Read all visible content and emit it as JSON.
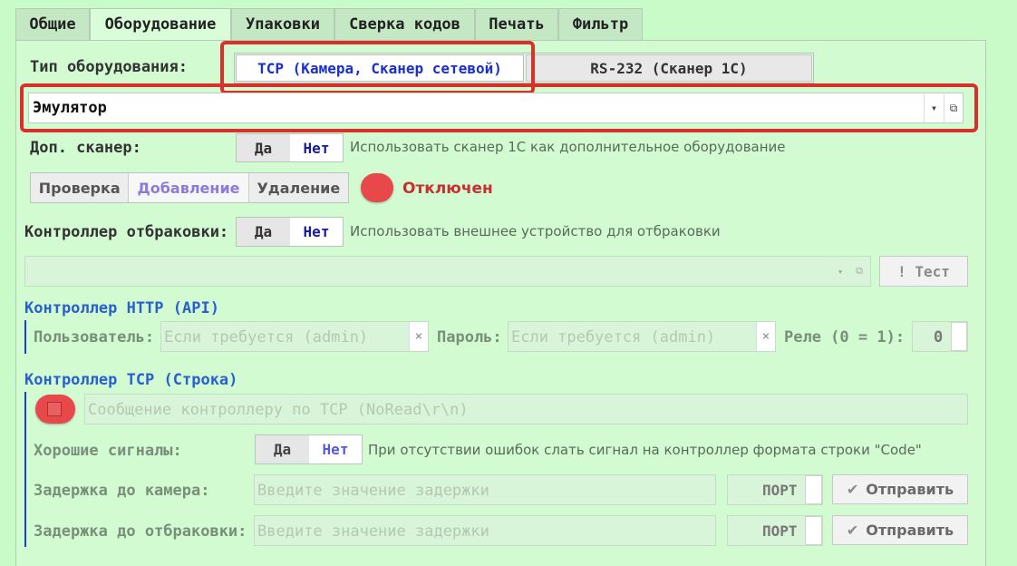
{
  "tabs": [
    "Общие",
    "Оборудование",
    "Упаковки",
    "Сверка кодов",
    "Печать",
    "Фильтр"
  ],
  "equipment_type": {
    "label": "Тип оборудования:",
    "options": [
      "TCP (Камера, Сканер сетевой)",
      "RS-232 (Сканер 1С)"
    ],
    "selected": "TCP (Камера, Сканер сетевой)"
  },
  "device_select": {
    "value": "Эмулятор",
    "arrow": "▾",
    "open_icon": "⧉"
  },
  "extra_scanner": {
    "label": "Доп. сканер:",
    "yes": "Да",
    "no": "Нет",
    "hint": "Использовать сканер 1С как дополнительное оборудование"
  },
  "mode": {
    "buttons": [
      "Проверка",
      "Добавление",
      "Удаление"
    ],
    "selected": "Добавление",
    "status_text": "Отключен",
    "status_color": "#e8484a"
  },
  "reject_controller": {
    "label": "Контроллер отбраковки:",
    "yes": "Да",
    "no": "Нет",
    "hint": "Использовать внешнее устройство для отбраковки",
    "test_button": "! Тест"
  },
  "http": {
    "title": "Контроллер HTTP (API)",
    "user_label": "Пользователь:",
    "user_placeholder": "Если требуется (admin)",
    "pass_label": "Пароль:",
    "pass_placeholder": "Если требуется (admin)",
    "relay_label": "Реле (0 = 1):",
    "relay_value": "0",
    "clear": "×"
  },
  "tcp": {
    "title": "Контроллер TCP (Строка)",
    "message_placeholder": "Сообщение контроллеру по TCP (NoRead\\r\\n)",
    "good_label": "Хорошие сигналы:",
    "yes": "Да",
    "no": "Нет",
    "good_hint": "При отсутствии ошибок слать сигнал на контроллер формата строки \"Code\"",
    "cam_delay_label": "Задержка до камера:",
    "reject_delay_label": "Задержка до отбраковки:",
    "delay_placeholder": "Введите значение задержки",
    "port": "ПОРТ",
    "send": "Отправить"
  }
}
